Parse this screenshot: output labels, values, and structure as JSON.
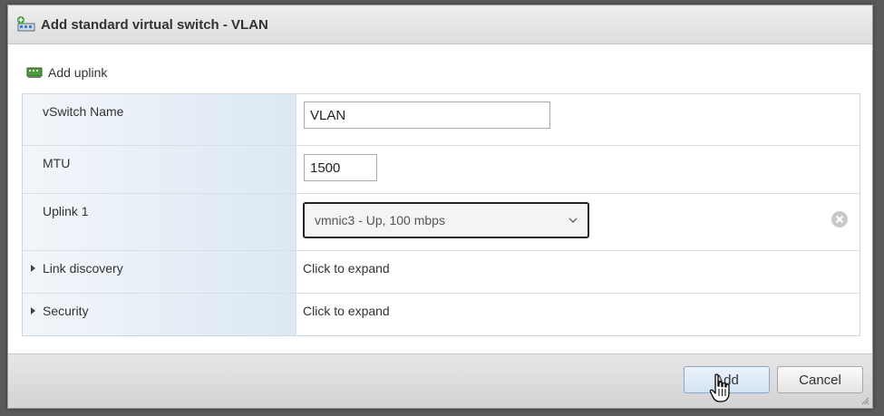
{
  "dialog": {
    "title": "Add standard virtual switch - VLAN",
    "title_icon": "vswitch-add-icon"
  },
  "toolbar": {
    "add_uplink_label": "Add uplink",
    "add_uplink_icon": "network-card-icon"
  },
  "form": {
    "vswitch_name": {
      "label": "vSwitch Name",
      "value": "VLAN"
    },
    "mtu": {
      "label": "MTU",
      "value": "1500"
    },
    "uplink1": {
      "label": "Uplink 1",
      "selected": "vmnic3 - Up, 100 mbps",
      "clear_icon": "clear-circle-icon"
    },
    "link_discovery": {
      "label": "Link discovery",
      "value": "Click to expand"
    },
    "security": {
      "label": "Security",
      "value": "Click to expand"
    }
  },
  "footer": {
    "add_label": "Add",
    "cancel_label": "Cancel"
  },
  "colors": {
    "label_column": "#dce8f3",
    "primary_button": "#d4e3f3",
    "title_bar": "#e6e6e6"
  }
}
